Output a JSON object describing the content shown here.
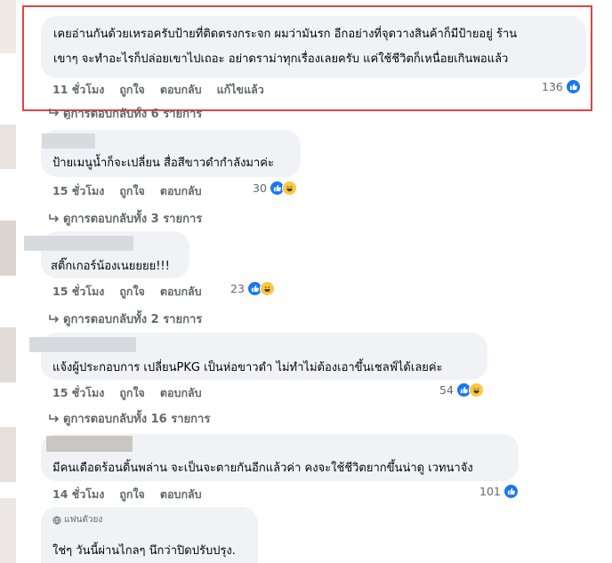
{
  "comments": [
    {
      "text_line1": "เคยอ่านกันด้วยเหรอครับป้ายที่ติดตรงกระจก ผมว่ามันรก อีกอย่างที่จุดวางสินค้าก็มีป้ายอยู่ ร้าน",
      "text_line2": "เขาๆ จะทำอะไรก็ปล่อยเขาไปเถอะ อย่าดราม่าทุกเรื่องเลยครับ แค่ใช้ชีวิตก็เหนื่อยเกินพอแล้ว",
      "time": "11 ชั่วโมง",
      "like": "ถูกใจ",
      "reply": "ตอบกลับ",
      "edited": "แก้ไขแล้ว",
      "reactions": "136",
      "replies": "ดูการตอบกลับทั้ง 6 รายการ"
    },
    {
      "text": "ป้ายเมนูน้ำก็จะเปลี่ยน สื่อสีขาวดำกำลังมาค่ะ",
      "time": "15 ชั่วโมง",
      "like": "ถูกใจ",
      "reply": "ตอบกลับ",
      "reactions": "30",
      "replies": "ดูการตอบกลับทั้ง 3 รายการ"
    },
    {
      "text": "สติ๊กเกอร์น้องเนยยยย!!!",
      "time": "15 ชั่วโมง",
      "like": "ถูกใจ",
      "reply": "ตอบกลับ",
      "reactions": "23",
      "replies": "ดูการตอบกลับทั้ง 2 รายการ"
    },
    {
      "text": "แจ้งผู้ประกอบการ เปลี่ยนPKG เป็นห่อขาวดำ ไม่ทำไม่ต้องเอาขึ้นเชลฟ์ได้เลยค่ะ",
      "time": "15 ชั่วโมง",
      "like": "ถูกใจ",
      "reply": "ตอบกลับ",
      "reactions": "54",
      "replies": "ดูการตอบกลับทั้ง 16 รายการ"
    },
    {
      "text": "มีคนเดือดร้อนดิ้นพล่าน จะเป็นจะตายกันอีกแล้วค่า คงจะใช้ชีวิตยากขึ้นน่าดู เวทนาจัง",
      "time": "14 ชั่วโมง",
      "like": "ถูกใจ",
      "reply": "ตอบกลับ",
      "reactions": "101"
    },
    {
      "badge": "แฟนตัวยง",
      "text": "ใช่ๆ วันนี้ผ่านไกลๆ นึกว่าปิดปรับปรุง."
    }
  ],
  "colors": {
    "bubble": "#f0f2f5",
    "meta": "#65676b",
    "like_blue": "#1877f2",
    "haha_yellow": "#f7c843",
    "highlight": "#e04545"
  }
}
